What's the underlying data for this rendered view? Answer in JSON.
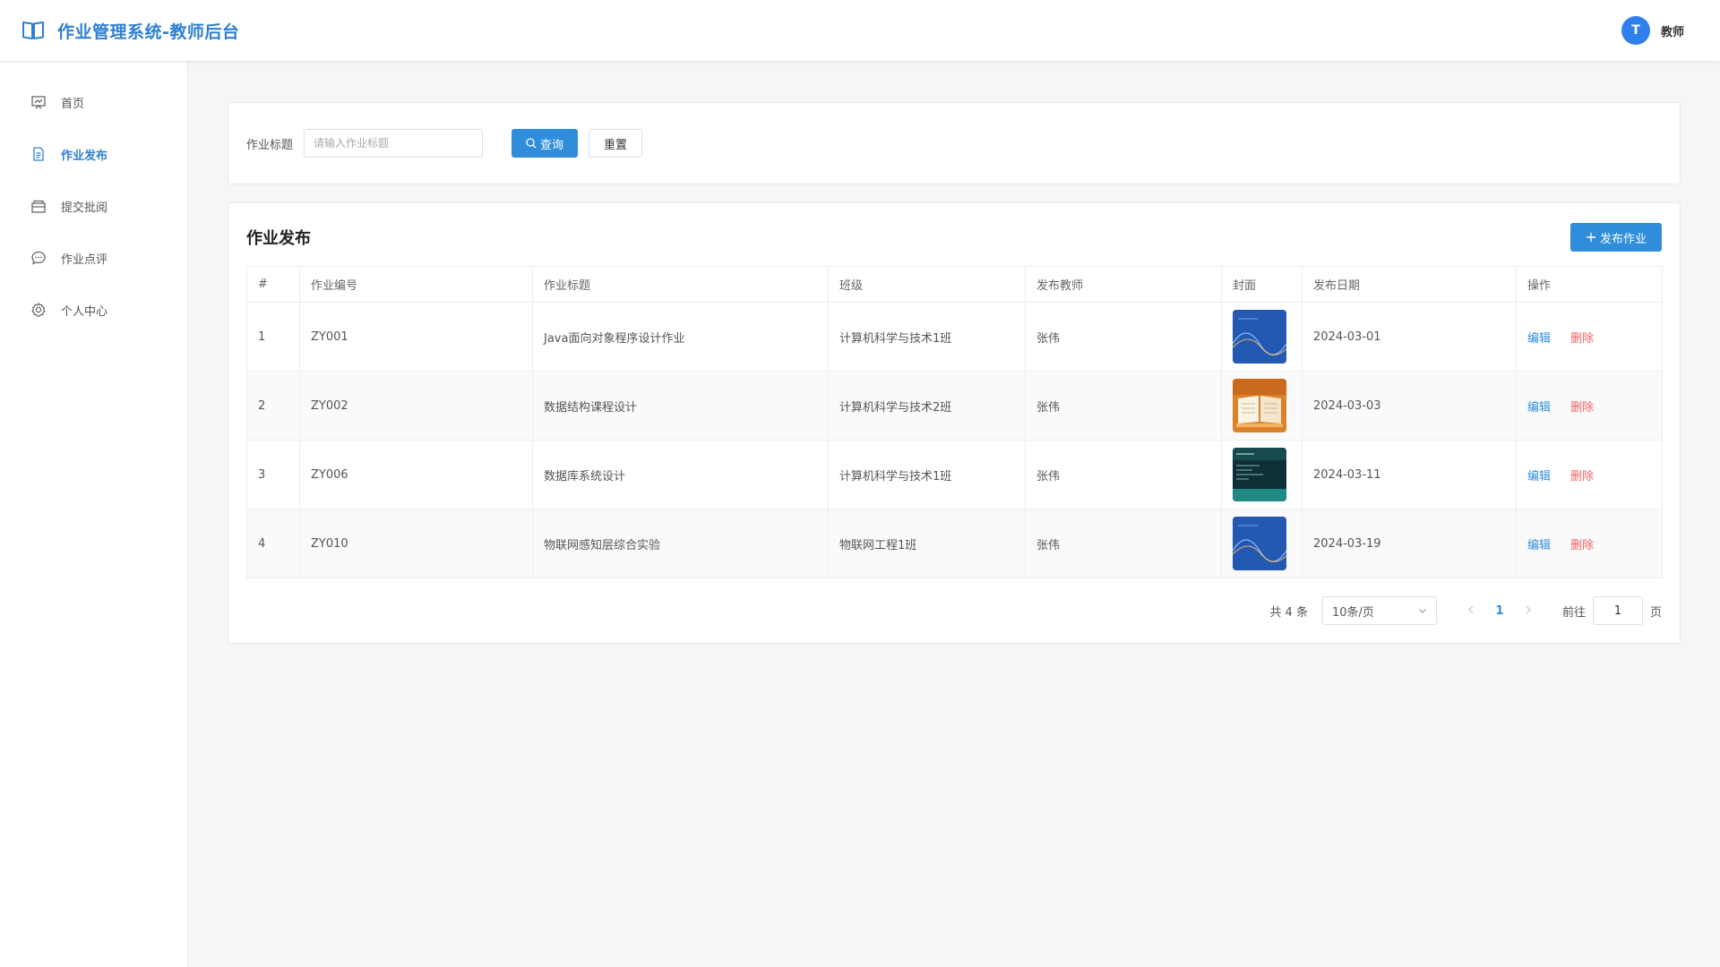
{
  "header": {
    "title": "作业管理系统-教师后台",
    "logo_icon": "book-icon",
    "user": {
      "avatar_letter": "T",
      "name": "教师"
    }
  },
  "sidebar": {
    "items": [
      {
        "label": "首页",
        "icon": "dashboard-icon",
        "active": false
      },
      {
        "label": "作业发布",
        "icon": "document-icon",
        "active": true
      },
      {
        "label": "提交批阅",
        "icon": "inbox-icon",
        "active": false
      },
      {
        "label": "作业点评",
        "icon": "comment-icon",
        "active": false
      },
      {
        "label": "个人中心",
        "icon": "gear-icon",
        "active": false
      }
    ]
  },
  "filter": {
    "label": "作业标题",
    "placeholder": "请输入作业标题",
    "value": "",
    "query_label": "查询",
    "reset_label": "重置"
  },
  "list": {
    "title": "作业发布",
    "publish_label": "发布作业",
    "columns": [
      "#",
      "作业编号",
      "作业标题",
      "班级",
      "发布教师",
      "封面",
      "发布日期",
      "操作"
    ],
    "rows": [
      {
        "index": "1",
        "code": "ZY001",
        "title": "Java面向对象程序设计作业",
        "class": "计算机科学与技术1班",
        "teacher": "张伟",
        "cover": "blue-wave",
        "date": "2024-03-01"
      },
      {
        "index": "2",
        "code": "ZY002",
        "title": "数据结构课程设计",
        "class": "计算机科学与技术2班",
        "teacher": "张伟",
        "cover": "orange-book",
        "date": "2024-03-03"
      },
      {
        "index": "3",
        "code": "ZY006",
        "title": "数据库系统设计",
        "class": "计算机科学与技术1班",
        "teacher": "张伟",
        "cover": "teal-code",
        "date": "2024-03-11"
      },
      {
        "index": "4",
        "code": "ZY010",
        "title": "物联网感知层综合实验",
        "class": "物联网工程1班",
        "teacher": "张伟",
        "cover": "blue-wave",
        "date": "2024-03-19"
      }
    ],
    "edit_label": "编辑",
    "delete_label": "删除"
  },
  "pager": {
    "total": "共 4 条",
    "page_size": "10条/页",
    "current_page": "1",
    "goto_label": "前往",
    "goto_value": "1",
    "goto_unit": "页"
  },
  "colors": {
    "primary": "#2f8ddc",
    "brand_title": "#2f7fd1",
    "danger": "#f06363"
  }
}
